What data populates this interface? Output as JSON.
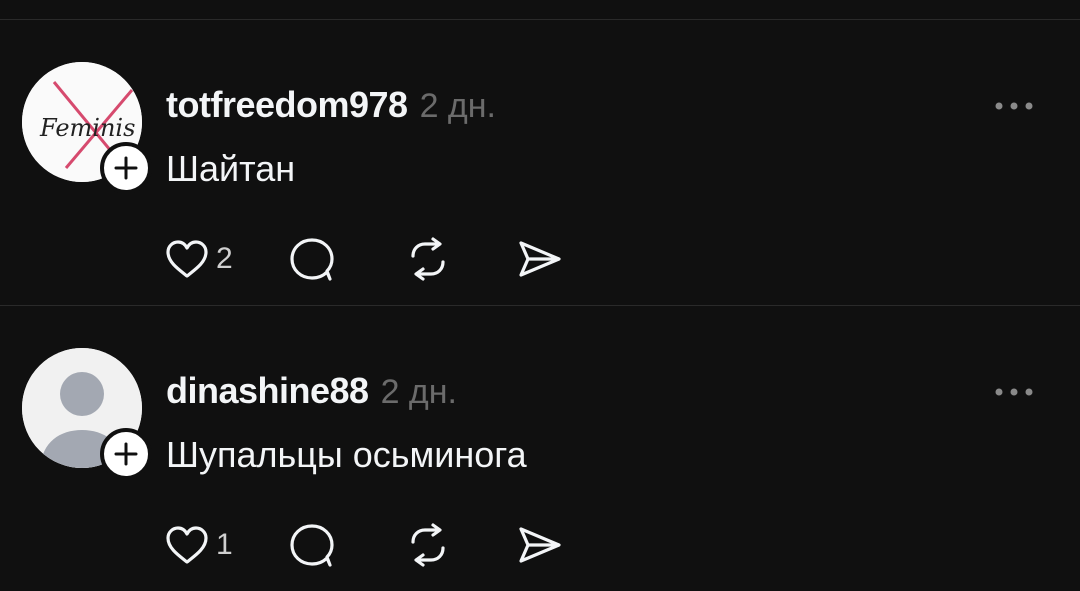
{
  "posts": [
    {
      "username": "totfreedom978",
      "time": "2 дн.",
      "text": "Шайтан",
      "avatar": {
        "type": "image",
        "label": "Feminis",
        "strike_color": "#d64a6e"
      },
      "likes": "2"
    },
    {
      "username": "dinashine88",
      "time": "2 дн.",
      "text": "Шупальцы осьминога",
      "avatar": {
        "type": "default"
      },
      "likes": "1"
    }
  ],
  "icons": {
    "like": "heart-icon",
    "reply": "comment-icon",
    "repost": "repost-icon",
    "share": "send-icon",
    "more": "more-icon",
    "follow": "plus-icon"
  },
  "colors": {
    "background": "#101010",
    "text": "#f3f5f7",
    "muted": "#6b6b6b",
    "divider": "#2a2a2a"
  }
}
